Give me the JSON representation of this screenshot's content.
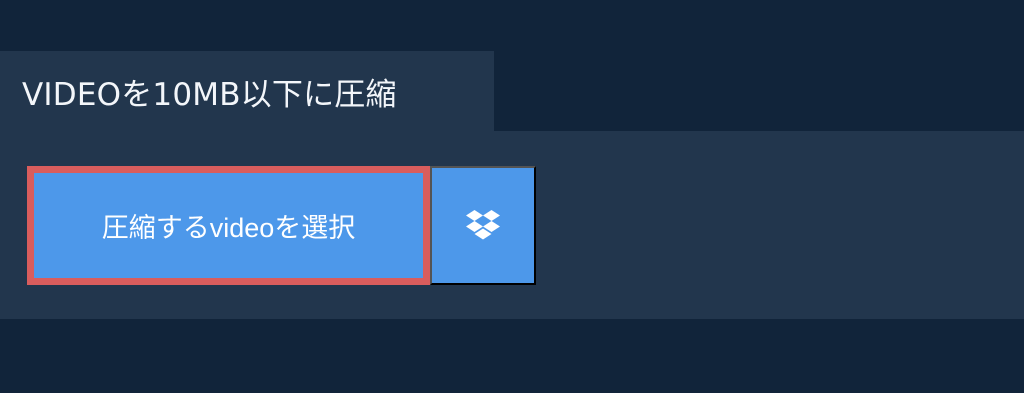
{
  "header": {
    "title": "VIDEOを10MB以下に圧縮"
  },
  "upload": {
    "select_label": "圧縮するvideoを選択",
    "dropbox_icon": "dropbox-icon"
  },
  "colors": {
    "background": "#11243a",
    "panel": "#22364d",
    "button": "#4d98ea",
    "selected_outline": "#d95d5d",
    "text": "#ffffff"
  }
}
